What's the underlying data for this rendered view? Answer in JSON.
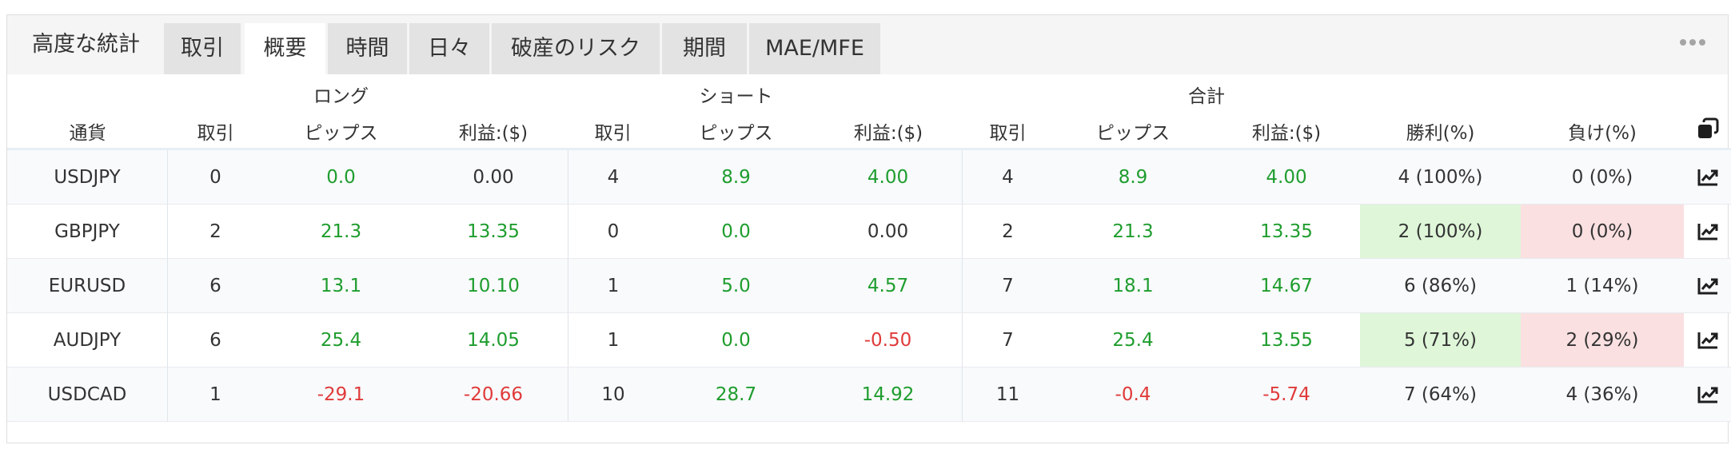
{
  "tabs": {
    "title": "高度な統計",
    "items": [
      "取引",
      "概要",
      "時間",
      "日々",
      "破産のリスク",
      "期間",
      "MAE/MFE"
    ],
    "active": "概要"
  },
  "menu_icon": "more-dots-icon",
  "table": {
    "groups": {
      "long": "ロング",
      "short": "ショート",
      "total": "合計"
    },
    "columns": [
      "通貨",
      "取引",
      "ピップス",
      "利益:($)",
      "取引",
      "ピップス",
      "利益:($)",
      "取引",
      "ピップス",
      "利益:($)",
      "勝利(%)",
      "負け(%)"
    ],
    "copy_icon": "copy-icon",
    "row_icon": "chart-line-icon",
    "rows": [
      {
        "symbol": "USDJPY",
        "long_trades": "0",
        "long_pips": "0.0",
        "long_profit": "0.00",
        "short_trades": "4",
        "short_pips": "8.9",
        "short_profit": "4.00",
        "total_trades": "4",
        "total_pips": "8.9",
        "total_profit": "4.00",
        "wins": "4 (100%)",
        "losses": "0 (0%)"
      },
      {
        "symbol": "GBPJPY",
        "long_trades": "2",
        "long_pips": "21.3",
        "long_profit": "13.35",
        "short_trades": "0",
        "short_pips": "0.0",
        "short_profit": "0.00",
        "total_trades": "2",
        "total_pips": "21.3",
        "total_profit": "13.35",
        "wins": "2 (100%)",
        "losses": "0 (0%)"
      },
      {
        "symbol": "EURUSD",
        "long_trades": "6",
        "long_pips": "13.1",
        "long_profit": "10.10",
        "short_trades": "1",
        "short_pips": "5.0",
        "short_profit": "4.57",
        "total_trades": "7",
        "total_pips": "18.1",
        "total_profit": "14.67",
        "wins": "6 (86%)",
        "losses": "1 (14%)"
      },
      {
        "symbol": "AUDJPY",
        "long_trades": "6",
        "long_pips": "25.4",
        "long_profit": "14.05",
        "short_trades": "1",
        "short_pips": "0.0",
        "short_profit": "-0.50",
        "total_trades": "7",
        "total_pips": "25.4",
        "total_profit": "13.55",
        "wins": "5 (71%)",
        "losses": "2 (29%)"
      },
      {
        "symbol": "USDCAD",
        "long_trades": "1",
        "long_pips": "-29.1",
        "long_profit": "-20.66",
        "short_trades": "10",
        "short_pips": "28.7",
        "short_profit": "14.92",
        "total_trades": "11",
        "total_pips": "-0.4",
        "total_profit": "-5.74",
        "wins": "7 (64%)",
        "losses": "4 (36%)"
      }
    ]
  },
  "colors": {
    "positive": "#1f9d2e",
    "negative": "#e03a3a",
    "win_bg": "#dff6d9",
    "loss_bg": "#fae0e1"
  }
}
